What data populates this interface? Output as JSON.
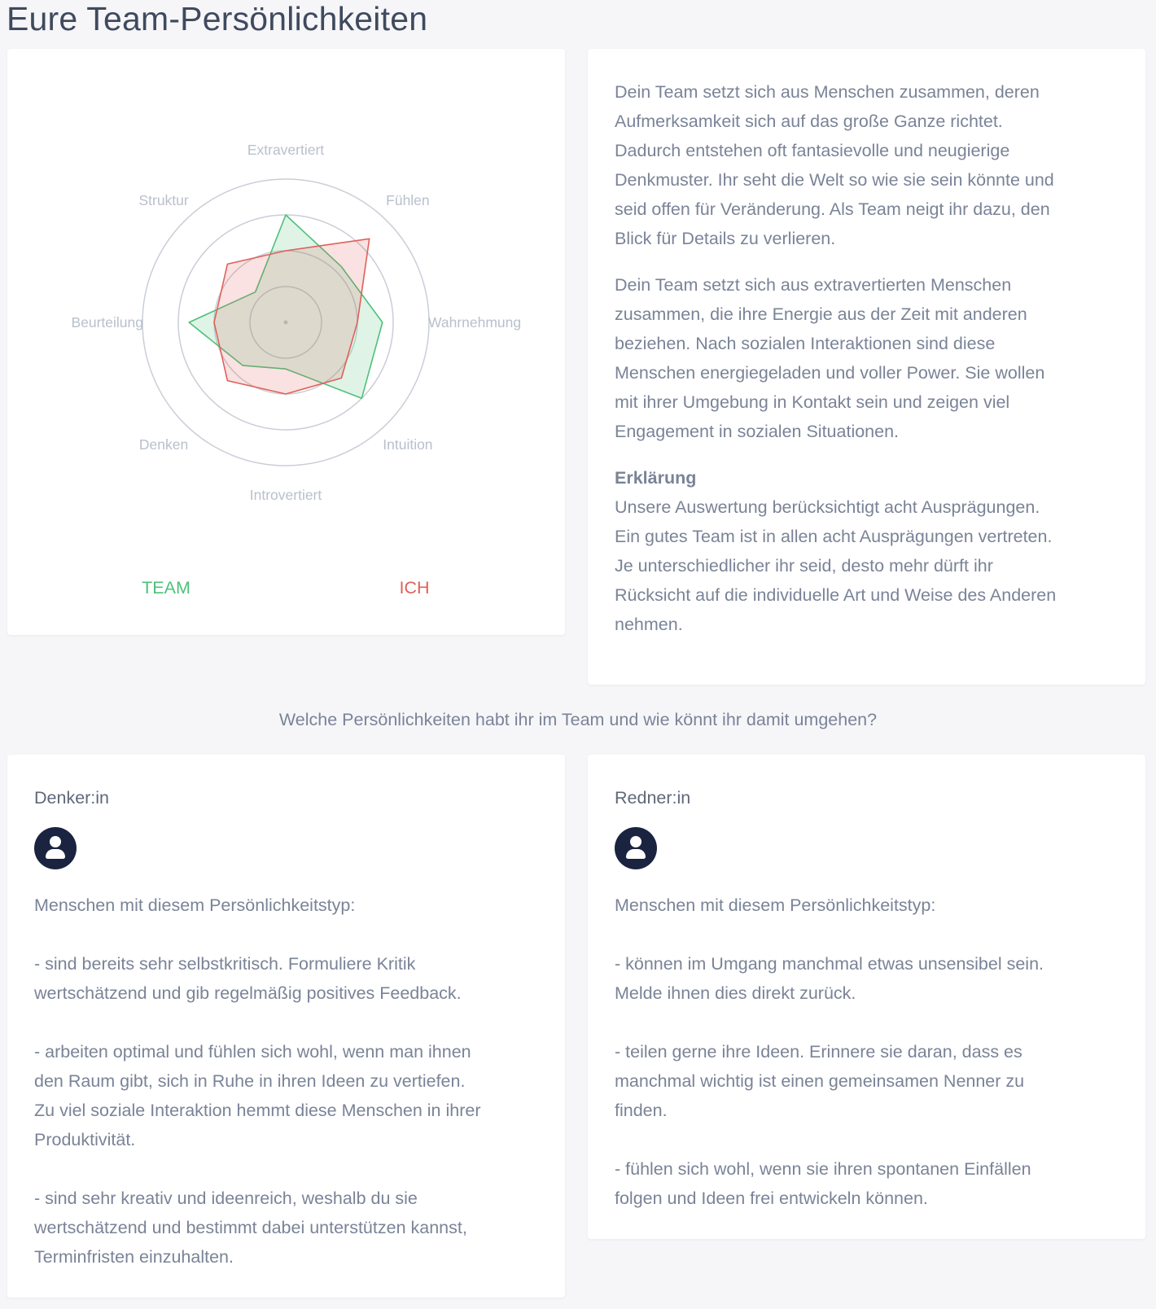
{
  "page": {
    "title": "Eure Team-Persönlichkeiten"
  },
  "chart_data": {
    "type": "radar",
    "axes": [
      "Extravertiert",
      "Fühlen",
      "Wahrnehmung",
      "Intuition",
      "Introvertiert",
      "Denken",
      "Beurteilung",
      "Struktur"
    ],
    "rlim": [
      0,
      4
    ],
    "rings": 4,
    "series": [
      {
        "name": "TEAM",
        "color": "#4ec07a",
        "fill": "rgba(78,192,122,0.18)",
        "values": [
          3.0,
          2.2,
          2.7,
          3.0,
          1.3,
          1.7,
          2.7,
          1.2
        ]
      },
      {
        "name": "ICH",
        "color": "#e0605a",
        "fill": "rgba(224,96,90,0.18)",
        "values": [
          2.0,
          3.3,
          2.0,
          2.2,
          2.0,
          2.3,
          2.0,
          2.3
        ]
      }
    ],
    "legend": [
      "TEAM",
      "ICH"
    ]
  },
  "legend": {
    "team": "TEAM",
    "ich": "ICH"
  },
  "summary": {
    "paragraph1": "Dein Team setzt sich aus Menschen zusammen, deren\nAufmerksamkeit sich auf das große Ganze richtet.\nDadurch entstehen oft fantasievolle und neugierige\nDenkmuster. Ihr seht die Welt so wie sie sein könnte und\nseid offen für Veränderung. Als Team neigt ihr dazu, den\nBlick für Details zu verlieren.",
    "paragraph2": "Dein Team setzt sich aus extravertierten Menschen\nzusammen, die ihre Energie aus der Zeit mit anderen\nbeziehen. Nach sozialen Interaktionen sind diese\nMenschen energiegeladen und voller Power. Sie wollen\nmit ihrer Umgebung in Kontakt sein und zeigen viel\nEngagement in sozialen Situationen.",
    "explanation_heading": "Erklärung",
    "explanation_text": "Unsere Auswertung berücksichtigt acht Ausprägungen.\nEin gutes Team ist in allen acht Ausprägungen vertreten.\nJe unterschiedlicher ihr seid, desto mehr dürft ihr\nRücksicht auf die individuelle Art und Weise des Anderen\nnehmen."
  },
  "question": "Welche Persönlichkeiten habt ihr im Team und wie könnt ihr damit umgehen?",
  "types": {
    "denker": {
      "title": "Denker:in",
      "text": "Menschen mit diesem Persönlichkeitstyp:\n\n- sind bereits sehr selbstkritisch. Formuliere Kritik\nwertschätzend und gib regelmäßig positives Feedback.\n\n- arbeiten optimal und fühlen sich wohl, wenn man ihnen\nden Raum gibt, sich in Ruhe in ihren Ideen zu vertiefen.\nZu viel soziale Interaktion hemmt diese Menschen in ihrer\nProduktivität.\n\n- sind sehr kreativ und ideenreich, weshalb du sie\nwertschätzend und bestimmt dabei unterstützen kannst,\nTerminfristen einzuhalten."
    },
    "redner": {
      "title": "Redner:in",
      "text": "Menschen mit diesem Persönlichkeitstyp:\n\n- können im Umgang manchmal etwas unsensibel sein.\nMelde ihnen dies direkt zurück.\n\n- teilen gerne ihre Ideen. Erinnere sie daran, dass es\nmanchmal wichtig ist einen gemeinsamen Nenner zu\nfinden.\n\n- fühlen sich wohl, wenn sie ihren spontanen Einfällen\nfolgen und Ideen frei entwickeln können."
    }
  },
  "icons": {
    "avatar": "user-icon"
  }
}
